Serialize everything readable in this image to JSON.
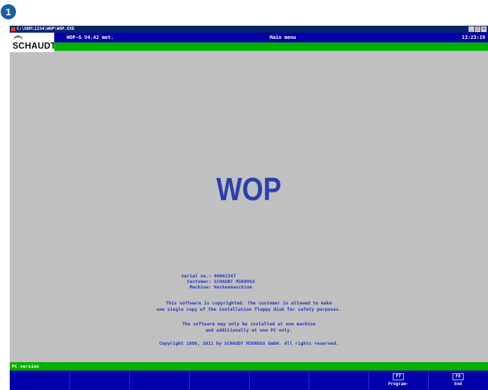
{
  "step_badge": "1",
  "window": {
    "title": "C:\\OEM\\1234\\WOP\\WOP.EXE",
    "controls": [
      "_",
      "□",
      "×"
    ]
  },
  "logo": {
    "text": "SCHAUDT"
  },
  "header": {
    "version": "WOP-G V4.42 met.",
    "screen_title": "Main menu",
    "time": "13:23:19"
  },
  "main": {
    "app_name": "WOP",
    "info": [
      {
        "label": "Serial no.:",
        "value": "00001347"
      },
      {
        "label": "Customer:",
        "value": "SCHAUDT MIKROSA"
      },
      {
        "label": "Machine:",
        "value": "Nockenmaschine"
      }
    ],
    "notice_1": [
      "This software is copyrighted. The customer is allowed to make",
      "one single copy of the installation floppy disk for safety purposes."
    ],
    "notice_2": [
      "The software may only be installed at one machine",
      "and additionally at one PC only."
    ],
    "copyright": "Copyright 1996, 2011 by SCHAUDT MIKROSA GmbH. All rights reserved."
  },
  "status": {
    "text": "PC version"
  },
  "fkeys": [
    {
      "key": "F7",
      "label": "Program-"
    },
    {
      "key": "F8",
      "label": "End"
    }
  ]
}
